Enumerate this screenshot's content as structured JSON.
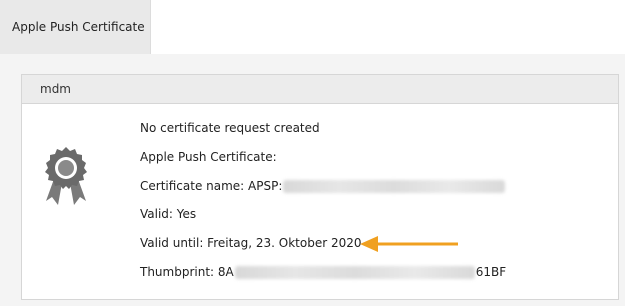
{
  "tabs": {
    "active_label": "Apple Push Certificate"
  },
  "panel": {
    "title": "mdm",
    "lines": {
      "request_status": "No certificate request created",
      "apple_push_cert": "Apple Push Certificate:",
      "cert_name_prefix": "Certificate name: APSP:",
      "valid": "Valid: Yes",
      "valid_until": "Valid until: Freitag, 23. Oktober 2020",
      "thumbprint_prefix": "Thumbprint: 8A",
      "thumbprint_suffix": "61BF"
    }
  },
  "icons": {
    "certificate": "certificate-badge-icon",
    "annotation_arrow": "arrow-left-icon"
  },
  "colors": {
    "arrow": "#f0a020",
    "badge": "#6a6a6a",
    "tab_active_bg": "#e9e9e9"
  }
}
